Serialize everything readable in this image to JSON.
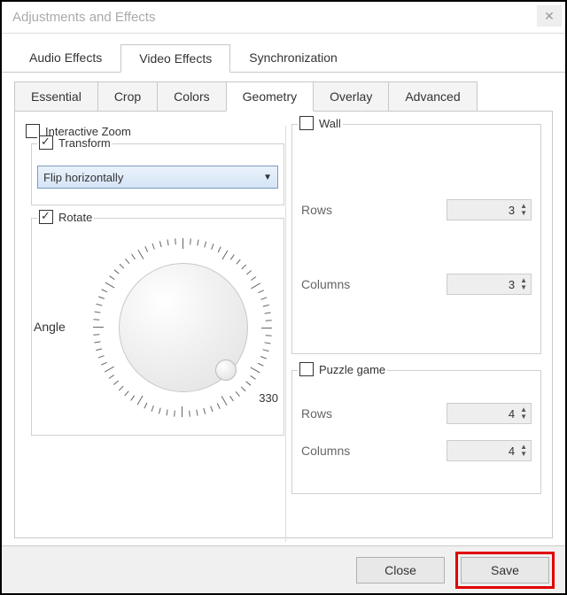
{
  "window": {
    "title": "Adjustments and Effects"
  },
  "main_tabs": {
    "audio": "Audio Effects",
    "video": "Video Effects",
    "sync": "Synchronization"
  },
  "sub_tabs": {
    "essential": "Essential",
    "crop": "Crop",
    "colors": "Colors",
    "geometry": "Geometry",
    "overlay": "Overlay",
    "advanced": "Advanced"
  },
  "geometry": {
    "interactive_zoom": {
      "label": "Interactive Zoom",
      "checked": false
    },
    "transform": {
      "label": "Transform",
      "checked": true,
      "selected": "Flip horizontally"
    },
    "rotate": {
      "label": "Rotate",
      "checked": true,
      "angle_label": "Angle",
      "value_label": "330",
      "value": 330
    },
    "wall": {
      "label": "Wall",
      "checked": false,
      "rows": {
        "label": "Rows",
        "value": 3
      },
      "columns": {
        "label": "Columns",
        "value": 3
      }
    },
    "puzzle": {
      "label": "Puzzle game",
      "checked": false,
      "rows": {
        "label": "Rows",
        "value": 4
      },
      "columns": {
        "label": "Columns",
        "value": 4
      }
    }
  },
  "footer": {
    "close": "Close",
    "save": "Save"
  }
}
